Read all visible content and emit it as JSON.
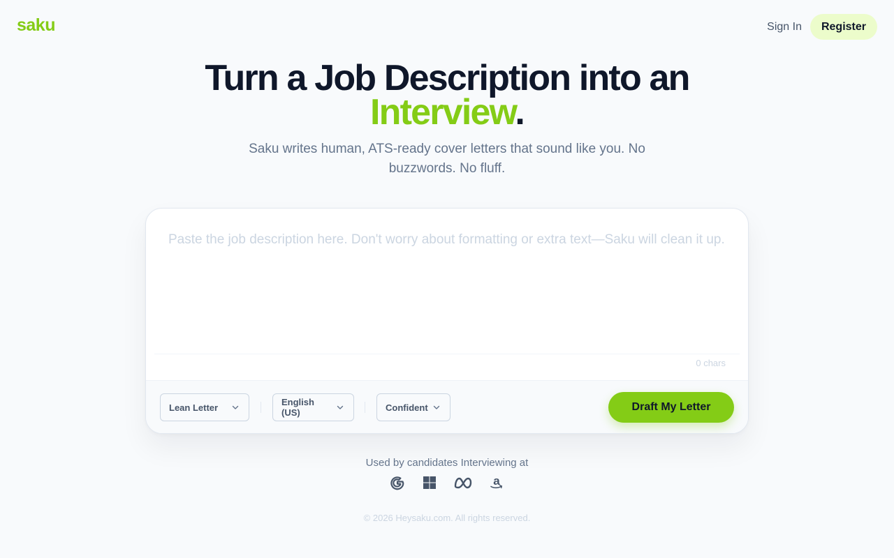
{
  "header": {
    "logo": "saku",
    "sign_in": "Sign In",
    "register": "Register"
  },
  "hero": {
    "title_line1": "Turn a Job Description into an",
    "title_accent": "Interview",
    "title_end": ".",
    "subtitle": "Saku writes human, ATS-ready cover letters that sound like you. No buzzwords. No fluff."
  },
  "composer": {
    "placeholder": "Paste the job description here. Don't worry about formatting or extra text—Saku will clean it up.",
    "value": "",
    "char_count": "0 chars",
    "style_select": "Lean Letter",
    "language_select": "English (US)",
    "tone_select": "Confident",
    "draft_button": "Draft My Letter"
  },
  "trust": {
    "label": "Used by candidates Interviewing at",
    "companies": [
      "google-icon",
      "windows-icon",
      "meta-icon",
      "amazon-icon"
    ]
  },
  "footer": {
    "copyright": "© 2026 Heysaku.com. All rights reserved."
  },
  "colors": {
    "accent": "#84cc16",
    "accent_soft": "#ecfccb",
    "heading": "#0f172a",
    "muted": "#64748b",
    "background": "#f8fafc"
  }
}
